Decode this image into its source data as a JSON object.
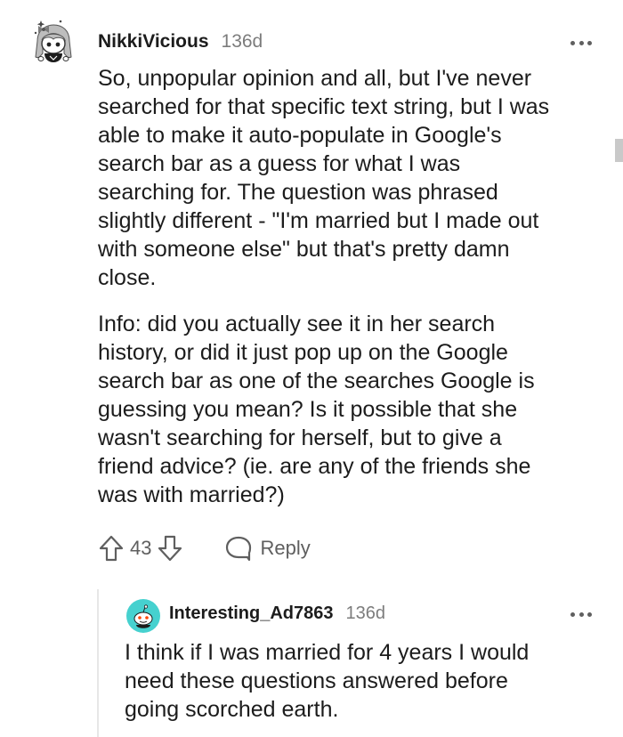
{
  "comment": {
    "username": "NikkiVicious",
    "age": "136d",
    "paragraphs": [
      "So, unpopular opinion and all, but I've never\nsearched for that specific text string, but I was\nable to make it auto-populate in Google's\nsearch bar as a guess for what I was\nsearching for. The question was phrased\nslightly different - \"I'm married but I made out\nwith someone else\" but that's pretty damn\nclose.",
      "Info: did you actually see it in her search\nhistory, or did it just pop up on the Google\nsearch bar as one of the searches Google is\nguessing you mean? Is it possible that she\nwasn't searching for herself, but to give a\nfriend advice? (ie. are any of the friends she\nwas with married?)"
    ],
    "vote_count": "43",
    "reply_label": "Reply",
    "icons": {
      "avatar": "snoo-avatar-nikkivicious",
      "upvote": "arrow-up-icon",
      "downvote": "arrow-down-icon",
      "reply": "speech-bubble-icon",
      "more": "more-dots-icon"
    }
  },
  "reply": {
    "username": "Interesting_Ad7863",
    "age": "136d",
    "paragraphs": [
      "I think if I was married for 4 years I would\nneed these questions answered before\ngoing scorched earth."
    ],
    "icons": {
      "avatar": "default-snoo-avatar",
      "more": "more-dots-icon"
    }
  },
  "colors": {
    "text": "#1c1c1c",
    "meta": "#7c7c7c",
    "icon": "#5f5f5f",
    "thread_line": "#e7e7e7",
    "avatar2_bg": "#46d1cf"
  }
}
